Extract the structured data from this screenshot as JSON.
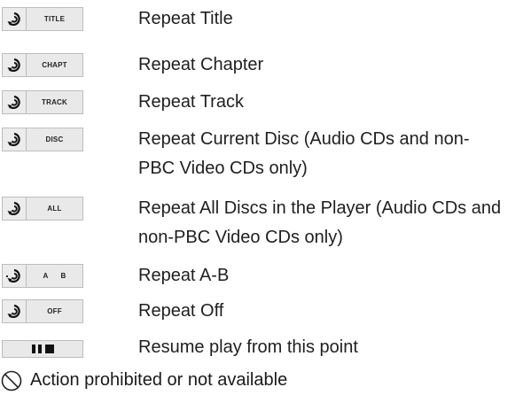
{
  "rows": [
    {
      "icon_label": "TITLE",
      "description": "Repeat Title"
    },
    {
      "icon_label": "CHAPT",
      "description": "Repeat Chapter"
    },
    {
      "icon_label": "TRACK",
      "description": "Repeat Track"
    },
    {
      "icon_label": "DISC",
      "description": "Repeat Current Disc (Audio CDs and non-PBC Video CDs only)"
    },
    {
      "icon_label": "ALL",
      "description": "Repeat All Discs in the Player (Audio CDs and non-PBC Video CDs only)"
    },
    {
      "icon_label": "A B",
      "description": "Repeat A-B"
    },
    {
      "icon_label": "OFF",
      "description": "Repeat Off"
    }
  ],
  "resume": {
    "description": "Resume play from this point"
  },
  "prohibited": {
    "description": "Action prohibited or not available"
  },
  "icons": {
    "repeat": "repeat-icon",
    "resume": "resume-icon",
    "prohibited": "prohibited-icon"
  }
}
